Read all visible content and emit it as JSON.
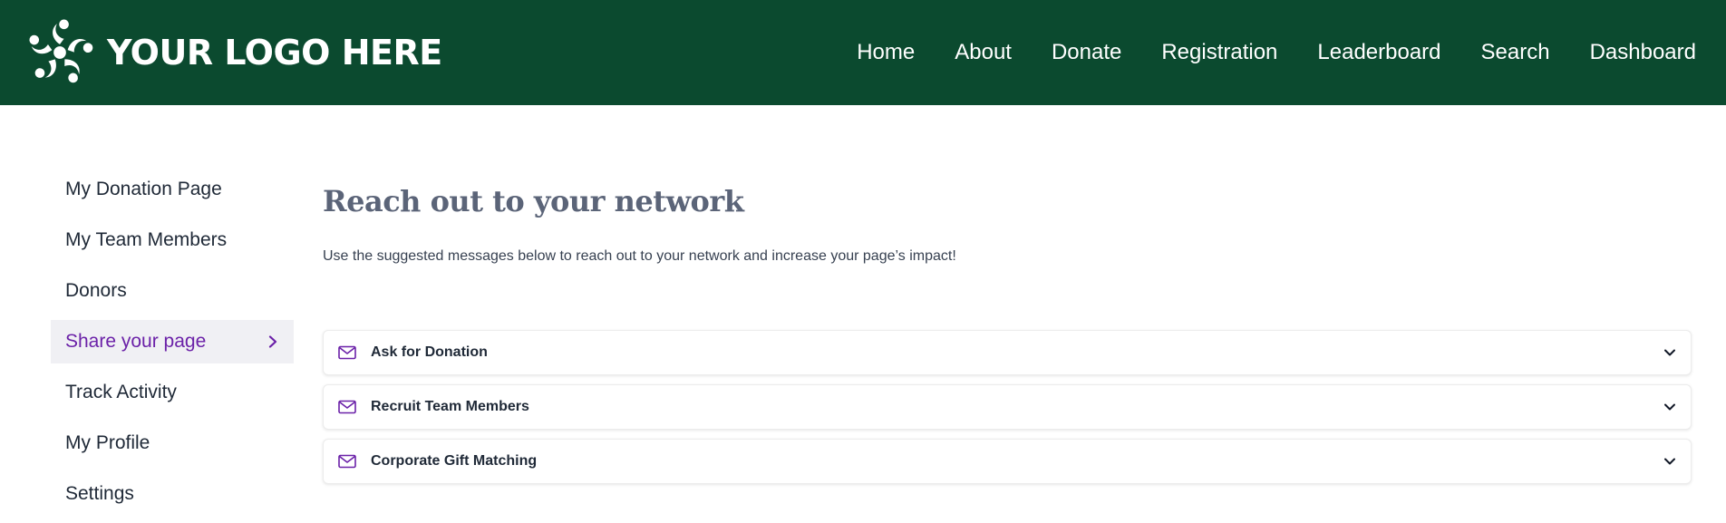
{
  "header": {
    "logo_text": "YOUR LOGO HERE",
    "logo_icon": "swirl-logo-icon",
    "nav": [
      {
        "label": "Home"
      },
      {
        "label": "About"
      },
      {
        "label": "Donate"
      },
      {
        "label": "Registration"
      },
      {
        "label": "Leaderboard"
      },
      {
        "label": "Search"
      },
      {
        "label": "Dashboard"
      }
    ]
  },
  "sidebar": {
    "items": [
      {
        "label": "My Donation Page"
      },
      {
        "label": "My Team Members"
      },
      {
        "label": "Donors"
      },
      {
        "label": "Share your page",
        "active": true
      },
      {
        "label": "Track Activity"
      },
      {
        "label": "My Profile"
      },
      {
        "label": "Settings"
      }
    ]
  },
  "main": {
    "title": "Reach out to your network",
    "subtitle": "Use the suggested messages below to reach out to your network and increase your page’s impact!",
    "accordions": [
      {
        "label": "Ask for Donation",
        "icon": "mail-icon"
      },
      {
        "label": "Recruit Team Members",
        "icon": "mail-icon"
      },
      {
        "label": "Corporate Gift Matching",
        "icon": "mail-icon"
      }
    ]
  },
  "colors": {
    "header_bg": "#0b4a2f",
    "accent": "#6b21a8",
    "title": "#5b6478"
  }
}
